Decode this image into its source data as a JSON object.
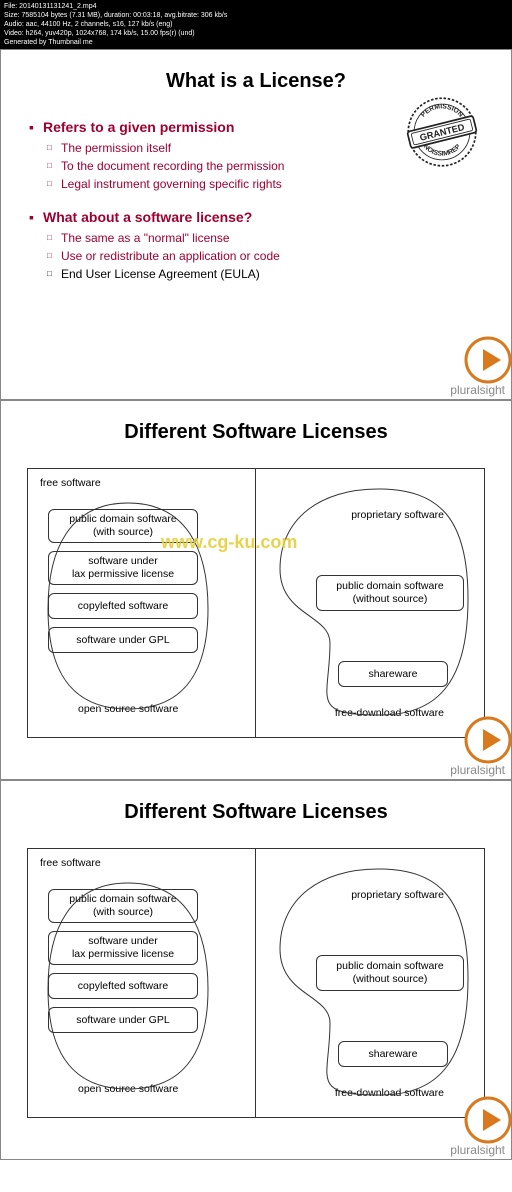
{
  "metadata": {
    "file": "File: 20140131131241_2.mp4",
    "size": "Size: 7585104 bytes (7.31 MB), duration: 00:03:18, avg.bitrate: 306 kb/s",
    "audio": "Audio: aac, 44100 Hz, 2 channels, s16, 127 kb/s (eng)",
    "video": "Video: h264, yuv420p, 1024x768, 174 kb/s, 15.00 fps(r) (und)",
    "generator": "Generated by Thumbnail me"
  },
  "stamp": {
    "top": "PERMISSION",
    "mid": "GRANTED",
    "bot": "NOISSIMREP"
  },
  "slide1": {
    "title": "What is a License?",
    "b1": "Refers to a given permission",
    "b1s1": "The permission itself",
    "b1s2": "To the document recording the permission",
    "b1s3": "Legal instrument governing specific rights",
    "b2": "What about a software license?",
    "b2s1": "The same as a \"normal\" license",
    "b2s2": "Use or redistribute an application or code",
    "b2s3": "End User License Agreement (EULA)"
  },
  "slide2": {
    "title": "Different Software Licenses",
    "watermark": "www.cg-ku.com"
  },
  "slide3": {
    "title": "Different Software Licenses"
  },
  "diagram": {
    "free_software": "free software",
    "public_with": "public domain software\n(with source)",
    "lax": "software under\nlax permissive license",
    "copyleft": "copylefted software",
    "gpl": "software under GPL",
    "opensrc": "open source software",
    "proprietary": "proprietary software",
    "public_without": "public domain software\n(without source)",
    "shareware": "shareware",
    "freedl": "free-download software"
  },
  "brand": "pluralsight"
}
